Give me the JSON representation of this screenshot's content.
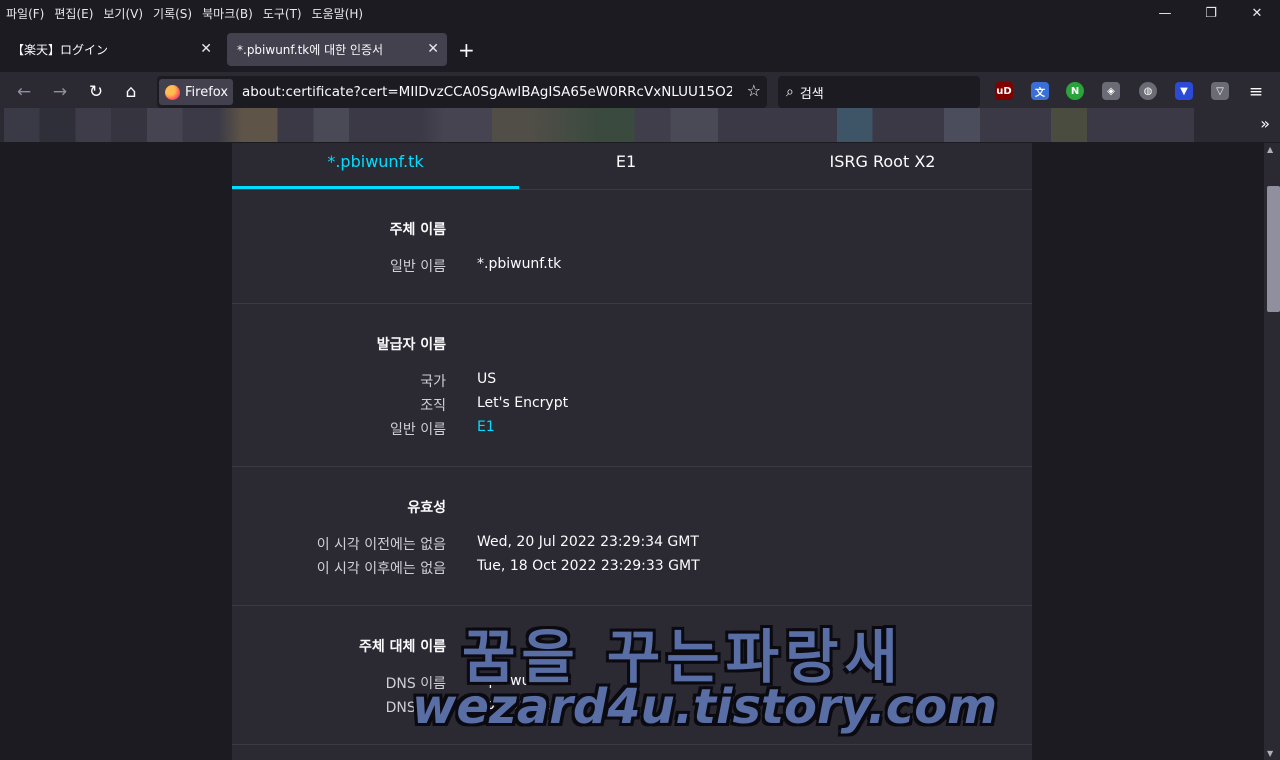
{
  "menubar": {
    "items": [
      "파일(F)",
      "편집(E)",
      "보기(V)",
      "기록(S)",
      "북마크(B)",
      "도구(T)",
      "도움말(H)"
    ],
    "minimize": "—",
    "restore": "❐",
    "close": "✕"
  },
  "tabs": [
    {
      "title": "【楽天】ログイン",
      "close": "✕"
    },
    {
      "title": "*.pbiwunf.tk에 대한 인증서",
      "close": "✕"
    }
  ],
  "new_tab_label": "+",
  "nav": {
    "back": "←",
    "forward": "→",
    "reload": "↻",
    "home": "⌂",
    "identity_label": "Firefox",
    "url": "about:certificate?cert=MIIDvzCCA0SgAwIBAgISA65eW0RRcVxNLUU15O2f3sWU",
    "bookmark_star": "☆",
    "search_placeholder": "검색",
    "search_icon": "⌕",
    "extensions": [
      {
        "name": "ublock-origin-icon",
        "text": "uD",
        "color": "#800000"
      },
      {
        "name": "translate-icon",
        "text": "文",
        "color": "#3b6fd8"
      },
      {
        "name": "n-extension-icon",
        "text": "N",
        "color": "#2aa33a"
      },
      {
        "name": "shield-icon",
        "text": "◈",
        "color": "#6b6b75"
      },
      {
        "name": "globe-icon",
        "text": "◍",
        "color": "#6b6b75"
      },
      {
        "name": "vpn-icon",
        "text": "▼",
        "color": "#2b4bd6"
      },
      {
        "name": "privacy-badger-icon",
        "text": "▽",
        "color": "#6b6b75"
      }
    ],
    "menu": "≡"
  },
  "bookmarks": {
    "overflow": "»"
  },
  "cert": {
    "tabs": [
      "*.pbiwunf.tk",
      "E1",
      "ISRG Root X2"
    ],
    "subject": {
      "title": "주체 이름",
      "rows": [
        {
          "k": "일반 이름",
          "v": "*.pbiwunf.tk"
        }
      ]
    },
    "issuer": {
      "title": "발급자 이름",
      "rows": [
        {
          "k": "국가",
          "v": "US"
        },
        {
          "k": "조직",
          "v": "Let's Encrypt"
        },
        {
          "k": "일반 이름",
          "v": "E1"
        }
      ]
    },
    "validity": {
      "title": "유효성",
      "rows": [
        {
          "k": "이 시각 이전에는 없음",
          "v": "Wed, 20 Jul 2022 23:29:34 GMT"
        },
        {
          "k": "이 시각 이후에는 없음",
          "v": "Tue, 18 Oct 2022 23:29:33 GMT"
        }
      ]
    },
    "san": {
      "title": "주체 대체 이름",
      "rows": [
        {
          "k": "DNS 이름",
          "v": "*.pbiwunf.tk"
        },
        {
          "k": "DNS 이름",
          "v": "pbiwunf.tk"
        }
      ]
    }
  },
  "watermark": {
    "korean": "꿈을 꾸는파랑새",
    "url": "wezard4u.tistory.com"
  },
  "colors": {
    "accent": "#00ddff",
    "bg": "#1c1b22",
    "panel": "#2b2a33"
  }
}
